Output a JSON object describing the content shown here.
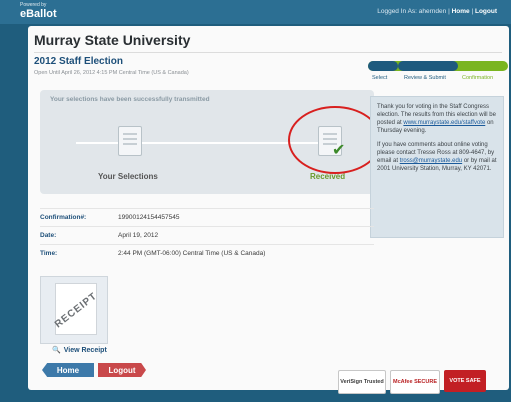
{
  "header": {
    "powered_by": "Powered by",
    "brand": "eBallot",
    "logged_in_as": "Logged In As: ahernden |",
    "home_link": "Home",
    "separator": "|",
    "logout_link": "Logout"
  },
  "page": {
    "university": "Murray State University",
    "election_title": "2012 Staff Election",
    "open_until": "Open Until April 26, 2012 4:15 PM Central Time (US & Canada)"
  },
  "steps": {
    "select": "Select",
    "review": "Review & Submit",
    "confirmation": "Confirmation",
    "progress_fraction": 1.0
  },
  "transmission": {
    "message": "Your selections have been successfully transmitted",
    "your_selections": "Your Selections",
    "received": "Received"
  },
  "thanks": {
    "p1_prefix": "Thank you for voting in the Staff Congress election. The results from this election will be posted at",
    "p1_link": "www.murraystate.edu/staffvote",
    "p1_suffix": "on Thursday evening.",
    "p2_prefix": "If you have comments about online voting please contact Tresse Ross at 809-4647, by email at",
    "p2_link": "tross@murraystate.edu",
    "p2_suffix": "or by mail at 2001 University Station, Murray, KY 42071."
  },
  "details": {
    "confirmation_label": "Confirmation#:",
    "confirmation_value": "19900124154457545",
    "date_label": "Date:",
    "date_value": "April 19, 2012",
    "time_label": "Time:",
    "time_value": "2:44 PM (GMT-06:00) Central Time (US & Canada)"
  },
  "receipt": {
    "stamp": "RECEIPT",
    "view_label": "View Receipt"
  },
  "buttons": {
    "home": "Home",
    "logout": "Logout"
  },
  "badges": {
    "verisign": "VeriSign Trusted",
    "mcafee": "McAfee SECURE",
    "votesafe": "VOTE SAFE"
  },
  "colors": {
    "accent_blue": "#1d4f79",
    "success_green": "#7ab520",
    "logout_red": "#c9494b",
    "annotation_red": "#d8201f"
  }
}
